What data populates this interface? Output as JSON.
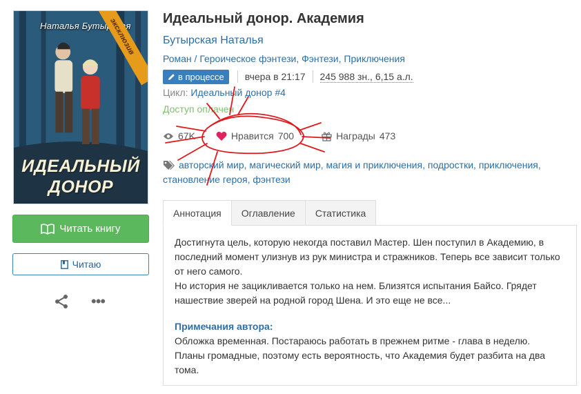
{
  "book": {
    "title": "Идеальный донор. Академия",
    "author": "Бутырская Наталья",
    "genres": [
      "Роман / Героическое фэнтези",
      "Фэнтези",
      "Приключения"
    ],
    "status_badge": "в процессе",
    "updated": "вчера в 21:17",
    "size": "245 988 зн., 6,15 а.л.",
    "cycle_label": "Цикл:",
    "cycle_name": "Идеальный донор #4",
    "access": "Доступ оплачен",
    "views": "67K",
    "likes_label": "Нравится",
    "likes_count": "700",
    "awards_label": "Награды",
    "awards_count": "473",
    "tags": [
      "авторский мир",
      "магический мир",
      "магия и приключения",
      "подростки",
      "приключения",
      "становление героя",
      "фэнтези"
    ]
  },
  "cover": {
    "author": "Наталья Бутырская",
    "title_line1": "ИДЕАЛЬНЫЙ",
    "title_line2": "ДОНОР",
    "ribbon": "эксклюзив"
  },
  "actions": {
    "read_button": "Читать книгу",
    "reading_button": "Читаю"
  },
  "tabs": [
    "Аннотация",
    "Оглавление",
    "Статистика"
  ],
  "annotation": {
    "paragraph1": "Достигнута цель, которую некогда поставил Мастер. Шен поступил в Академию, в последний момент улизнув из рук министра и стражников. Теперь все зависит только от него самого.",
    "paragraph2": "Но история не зацикливается только на нем. Близятся испытания Байсо. Грядет нашествие зверей на родной город Шена. И это еще не все...",
    "notes_heading": "Примечания автора:",
    "notes_line1": "Обложка временная. Постараюсь работать в прежнем ритме - глава в неделю.",
    "notes_line2": "Планы громадные, поэтому есть вероятность, что Академия будет разбита на два тома."
  },
  "colors": {
    "link": "#2d6ea6",
    "read_button": "#5cb85c",
    "badge": "#3a7fbd",
    "access": "#7cc26b",
    "heart": "#e0245e",
    "scribble": "#e0181b"
  }
}
